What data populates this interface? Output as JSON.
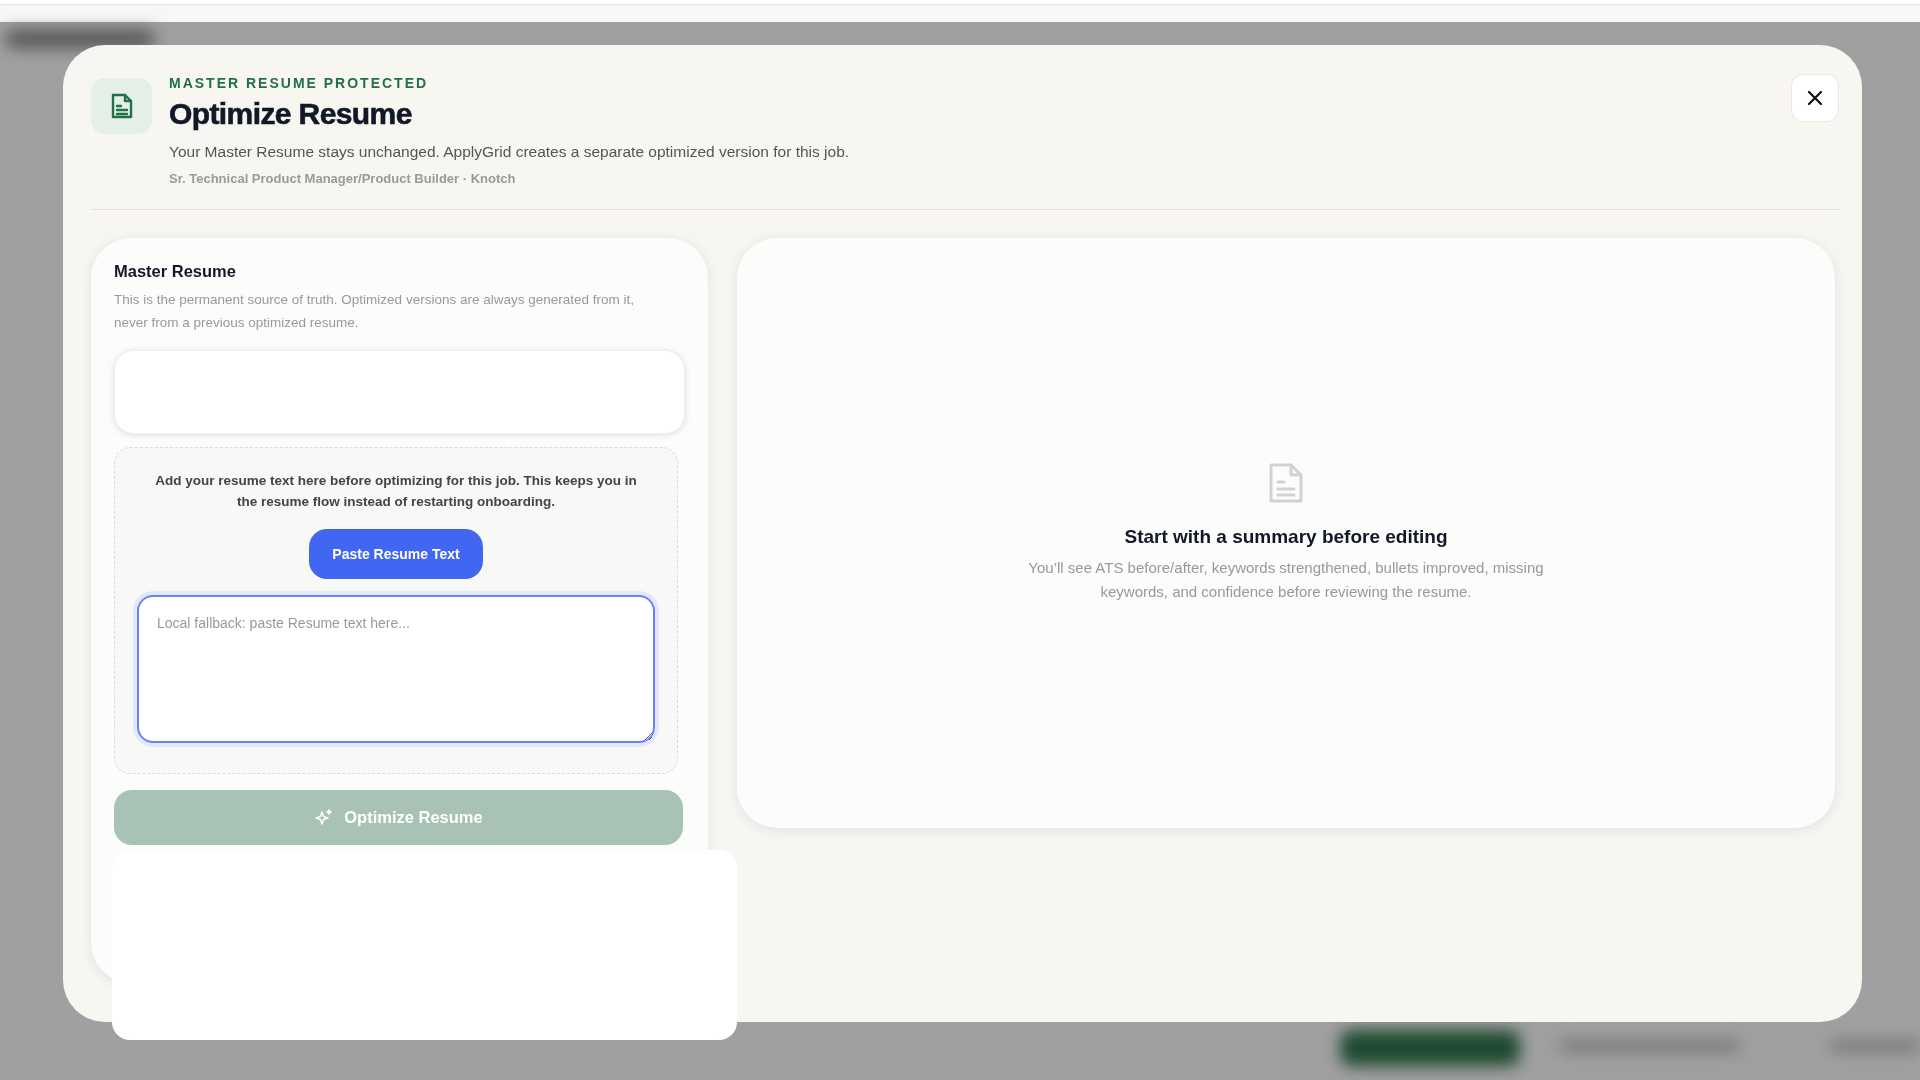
{
  "modal": {
    "eyebrow": "MASTER RESUME PROTECTED",
    "title": "Optimize Resume",
    "subtitle": "Your Master Resume stays unchanged. ApplyGrid creates a separate optimized version for this job.",
    "job_line": "Sr. Technical Product Manager/Product Builder · Knotch"
  },
  "master_resume": {
    "title": "Master Resume",
    "description": "This is the permanent source of truth. Optimized versions are always generated from it, never from a previous optimized resume.",
    "prompt": "Add your resume text here before optimizing for this job. This keeps you in the resume flow instead of restarting onboarding.",
    "paste_button": "Paste Resume Text",
    "textarea": {
      "placeholder": "Local fallback: paste Resume text here...",
      "focused": true
    },
    "optimize_button": {
      "label": "Optimize Resume",
      "disabled": true
    }
  },
  "summary": {
    "title": "Start with a summary before editing",
    "description": "You’ll see ATS before/after, keywords strengthened, bullets improved, missing keywords, and confidence before reviewing the resume."
  }
}
